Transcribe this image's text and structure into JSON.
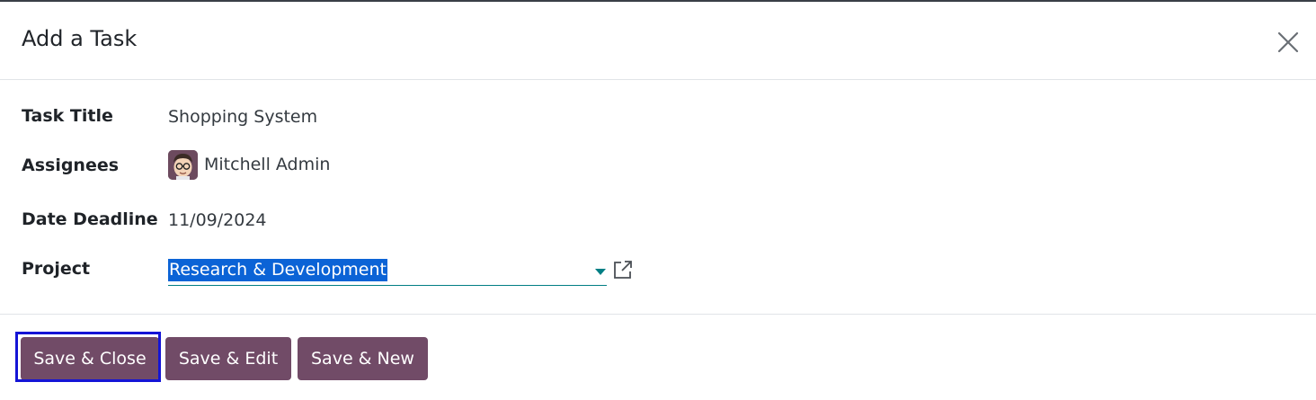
{
  "dialog": {
    "title": "Add a Task"
  },
  "form": {
    "task_title": {
      "label": "Task Title",
      "value": "Shopping System"
    },
    "assignees": {
      "label": "Assignees",
      "value": "Mitchell Admin"
    },
    "date_deadline": {
      "label": "Date Deadline",
      "value": "11/09/2024"
    },
    "project": {
      "label": "Project",
      "value": "Research & Development"
    }
  },
  "footer": {
    "save_close": "Save & Close",
    "save_edit": "Save & Edit",
    "save_new": "Save & New"
  },
  "icons": {
    "close": "close-icon",
    "dropdown": "caret-down-icon",
    "external": "external-link-icon",
    "avatar": "user-avatar"
  },
  "colors": {
    "primary": "#714b67",
    "accent": "#017e84",
    "selection": "#0b63d6",
    "focus": "#1414d6"
  }
}
